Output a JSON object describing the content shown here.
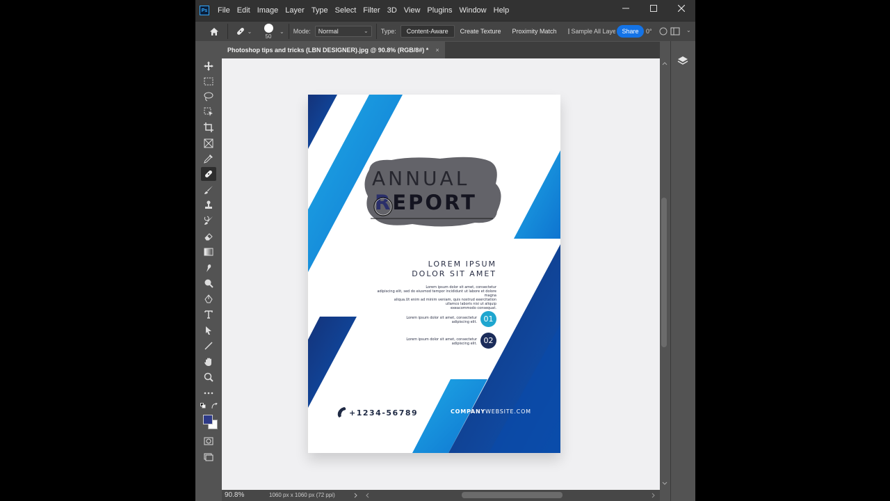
{
  "app": {
    "logo": "Ps",
    "menu": [
      "File",
      "Edit",
      "Image",
      "Layer",
      "Type",
      "Select",
      "Filter",
      "3D",
      "View",
      "Plugins",
      "Window",
      "Help"
    ]
  },
  "options": {
    "brush_size": "50",
    "mode_label": "Mode:",
    "mode_value": "Normal",
    "type_label": "Type:",
    "type_buttons": [
      "Content-Aware",
      "Create Texture",
      "Proximity Match"
    ],
    "sample_all_label": "Sample All Layers",
    "share_label": "Share",
    "angle_value": "0°"
  },
  "document": {
    "tab_title": "Photoshop tips and tricks (LBN DESIGNER).jpg @ 90.8% (RGB/8#) *",
    "close_glyph": "×"
  },
  "status": {
    "zoom": "90.8%",
    "doc_info": "1060 px x 1060 px (72 ppi)"
  },
  "poster": {
    "title_line1": "ANNUAL",
    "title_line2": "EPORT",
    "title_initial": "R",
    "heading_line1": "LOREM IPSUM",
    "heading_line2": "DOLOR SIT AMET",
    "body_lines": [
      "Lorem ipsum dolor sit amet, consectetur",
      "adipiscing elit, sed do eiusmod tempor incididunt ut labore et dolore magna",
      "aliqua.Ut enim ad minim veniam, quis nostrud exercitation",
      "ullamco laboris nisi ut aliquip",
      "exeacommodo consequat."
    ],
    "item1_lines": [
      "Lorem ipsum dolor sit amet, consectetur",
      "adipiscing elit."
    ],
    "item1_badge": "01",
    "item2_lines": [
      "Lorem ipsum dolor sit amet, consectetur",
      "adipiscing elit."
    ],
    "item2_badge": "02",
    "phone": "+1234-56789",
    "website_bold": "COMPANY",
    "website_rest": "WEBSITE.COM"
  },
  "colors": {
    "accent": "#1473e6",
    "poster_blue_light": "#1e9ee6",
    "poster_blue_dark": "#0b3c8c",
    "badge1": "#1fa6cf",
    "badge2": "#1b2c5a",
    "foreground_swatch": "#2e3a87"
  },
  "icons": {
    "home": "home-icon",
    "healing": "healing-brush-icon",
    "layers": "layers-icon"
  }
}
